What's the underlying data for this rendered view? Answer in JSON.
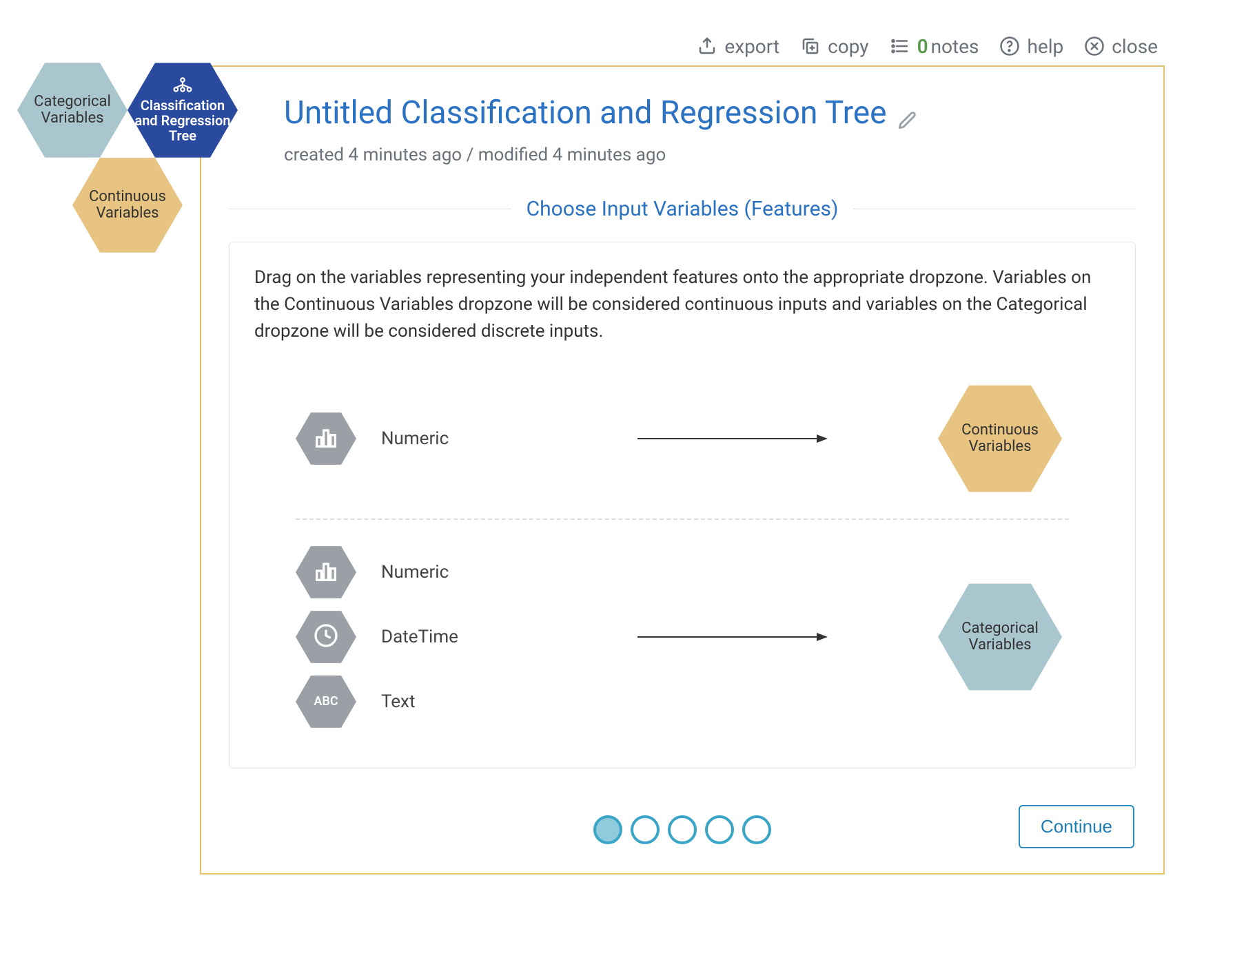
{
  "actions": {
    "export": "export",
    "copy": "copy",
    "notes_count": "0",
    "notes": "notes",
    "help": "help",
    "close": "close"
  },
  "side_hexes": {
    "categorical": "Categorical Variables",
    "tree": "Classification and Regression Tree",
    "continuous": "Continuous Variables"
  },
  "title": "Untitled Classification and Regression Tree",
  "meta": "created 4 minutes ago / modified 4 minutes ago",
  "section_title": "Choose Input Variables (Features)",
  "instructions": "Drag on the variables representing your independent features onto the appropriate dropzone. Variables on the Continuous Variables dropzone will be considered continuous inputs and variables on the Categorical dropzone will be considered discrete inputs.",
  "types": {
    "numeric": "Numeric",
    "datetime": "DateTime",
    "text": "Text"
  },
  "targets": {
    "continuous": "Continuous Variables",
    "categorical": "Categorical Variables"
  },
  "continue_label": "Continue",
  "step_count": 5,
  "step_active": 1,
  "colors": {
    "blue_light": "#a9c6cf",
    "blue_dark": "#2a4aa0",
    "tan": "#e7c481",
    "grey": "#9aa0a6"
  }
}
